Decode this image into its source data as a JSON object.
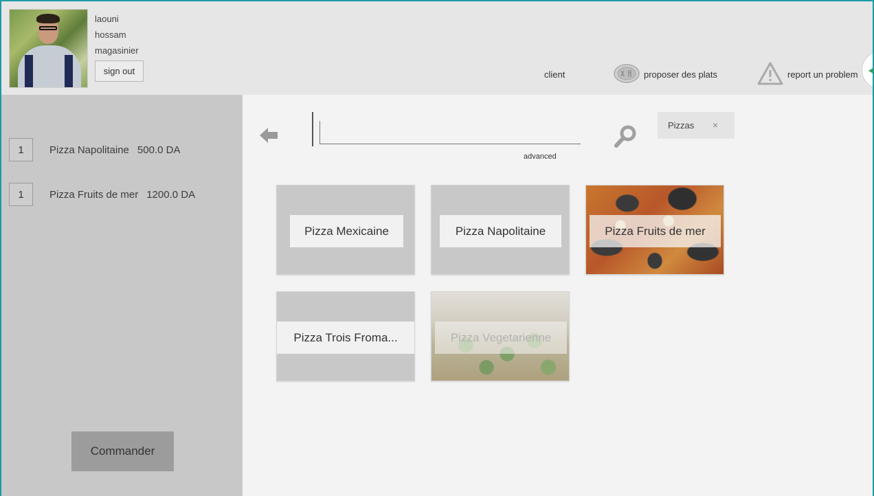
{
  "user": {
    "last_name": "laouni",
    "first_name": "hossam",
    "role": "magasinier",
    "signout_label": "sign out"
  },
  "nav": {
    "client_label": "client",
    "propose_label": "proposer des plats",
    "report_label": "report un problem"
  },
  "order": {
    "items": [
      {
        "qty": "1",
        "name": "Pizza Napolitaine",
        "price": "500.0 DA"
      },
      {
        "qty": "1",
        "name": "Pizza Fruits de mer",
        "price": "1200.0 DA"
      }
    ],
    "commander_label": "Commander"
  },
  "search": {
    "value": "",
    "advanced_label": "advanced",
    "filter_chip": "Pizzas",
    "filter_close": "×"
  },
  "dishes": [
    {
      "name": "Pizza Mexicaine",
      "image": "none"
    },
    {
      "name": "Pizza Napolitaine",
      "image": "none"
    },
    {
      "name": "Pizza Fruits de mer",
      "image": "seafood-pizza-photo"
    },
    {
      "name": "Pizza Trois Froma...",
      "image": "none"
    },
    {
      "name": "Pizza Vegetarienne",
      "image": "vegetarian-pizza-photo"
    }
  ],
  "colors": {
    "accent_border": "#1b9aa6",
    "header_bg": "#e6e6e6",
    "sidebar_bg": "#c8c8c8",
    "main_bg": "#f3f3f3",
    "commander_bg": "#9c9c9c",
    "toggle_arrow": "#2ea44f"
  }
}
